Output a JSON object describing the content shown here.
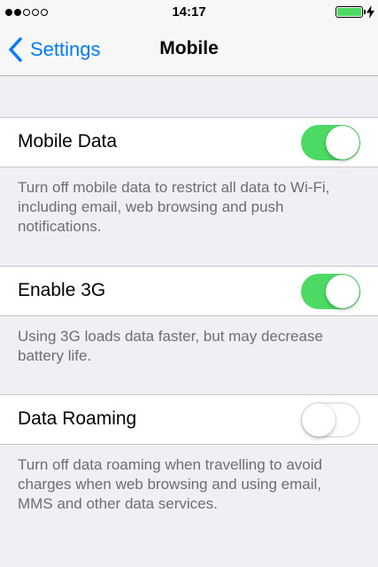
{
  "status_bar": {
    "signal_filled": 2,
    "signal_total": 5,
    "time": "14:17",
    "battery_level": 1.0,
    "battery_color": "#4cd964",
    "charging_icon": "lightning-bolt-icon"
  },
  "nav": {
    "back_label": "Settings",
    "back_icon": "chevron-left-icon",
    "title": "Mobile",
    "accent_color": "#007aff"
  },
  "settings": [
    {
      "label": "Mobile Data",
      "enabled": true,
      "footer": "Turn off mobile data to restrict all data to Wi-Fi, including email, web browsing and push notifications."
    },
    {
      "label": "Enable 3G",
      "enabled": true,
      "footer": "Using 3G loads data faster, but may decrease battery life."
    },
    {
      "label": "Data Roaming",
      "enabled": false,
      "footer": "Turn off data roaming when travelling to avoid charges when web browsing and using email, MMS and other data services."
    }
  ],
  "toggle_on_color": "#4cd964"
}
